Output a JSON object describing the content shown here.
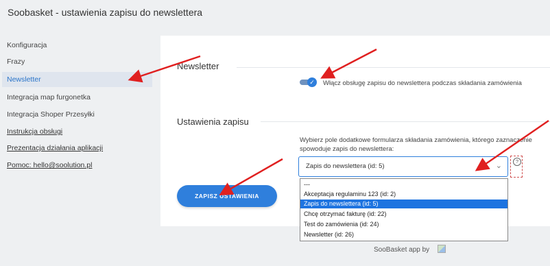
{
  "app": {
    "title": "Soobasket - ustawienia zapisu do newslettera"
  },
  "sidebar": {
    "items": [
      {
        "label": "Konfiguracja"
      },
      {
        "label": "Frazy"
      },
      {
        "label": "Newsletter"
      },
      {
        "label": "Integracja map furgonetka"
      },
      {
        "label": "Integracja Shoper Przesyłki"
      },
      {
        "label": "Instrukcja obsługi"
      },
      {
        "label": "Prezentacja działania aplikacji"
      },
      {
        "label": "Pomoc: hello@soolution.pl"
      }
    ],
    "active_index": 2
  },
  "newsletter": {
    "section_title": "Newsletter",
    "toggle_label": "Włącz obsługę zapisu do newslettera podczas składania zamówienia",
    "toggle_on": true
  },
  "settings": {
    "section_title": "Ustawienia zapisu",
    "field_label": "Wybierz pole dodatkowe formularza składania zamówienia, którego zaznaczenie spowoduje zapis do newslettera:",
    "select_value": "Zapis do newslettera (id: 5)",
    "help_icon": "?",
    "options": [
      "---",
      "Akceptacja regulaminu 123 (id: 2)",
      "Zapis do newslettera (id: 5)",
      "Chcę otrzymać fakturę (id: 22)",
      "Test do zamówienia (id: 24)",
      "Newsletter (id: 26)"
    ],
    "selected_index": 2
  },
  "actions": {
    "save_label": "ZAPISZ USTAWIENIA"
  },
  "footer": {
    "text": "SooBasket app by"
  },
  "colors": {
    "accent": "#2f7fdc",
    "arrow": "#e02020"
  }
}
